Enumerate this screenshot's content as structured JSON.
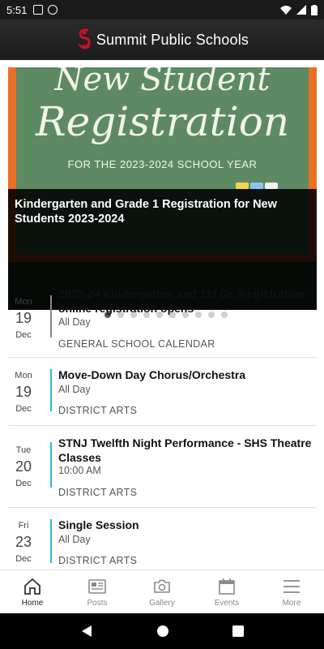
{
  "status_bar": {
    "time": "5:51"
  },
  "app_bar": {
    "title": "Summit Public Schools"
  },
  "carousel": {
    "board_line1": "New Student",
    "board_line2": "Registration",
    "board_line3": "FOR THE 2023-2024 SCHOOL YEAR",
    "caption": "Kindergarten and Grade 1 Registration for New Students 2023-2024",
    "page_count": 10,
    "active_index": 0
  },
  "events": [
    {
      "dow": "Mon",
      "day": "19",
      "mon": "Dec",
      "title": "2023-24 Kindergarten and 1st Gr. Registration - online registration opens",
      "time": "All Day",
      "category": "GENERAL SCHOOL CALENDAR",
      "color": "#888888"
    },
    {
      "dow": "Mon",
      "day": "19",
      "mon": "Dec",
      "title": "Move-Down Day Chorus/Orchestra",
      "time": "All Day",
      "category": "DISTRICT ARTS",
      "color": "#26bcd7"
    },
    {
      "dow": "Tue",
      "day": "20",
      "mon": "Dec",
      "title": "STNJ Twelfth Night Performance - SHS Theatre Classes",
      "time": "10:00 AM",
      "category": "DISTRICT ARTS",
      "color": "#26bcd7"
    },
    {
      "dow": "Fri",
      "day": "23",
      "mon": "Dec",
      "title": "Single Session",
      "time": "All Day",
      "category": "DISTRICT ARTS",
      "color": "#26bcd7"
    }
  ],
  "bottom_nav": [
    {
      "label": "Home",
      "icon": "home-icon",
      "active": true
    },
    {
      "label": "Posts",
      "icon": "posts-icon",
      "active": false
    },
    {
      "label": "Gallery",
      "icon": "camera-icon",
      "active": false
    },
    {
      "label": "Events",
      "icon": "calendar-icon",
      "active": false
    },
    {
      "label": "More",
      "icon": "menu-icon",
      "active": false
    }
  ],
  "colors": {
    "brand": "#c8102e",
    "accent": "#26bcd7",
    "board_frame": "#e86f24",
    "board": "#5d8a63"
  }
}
